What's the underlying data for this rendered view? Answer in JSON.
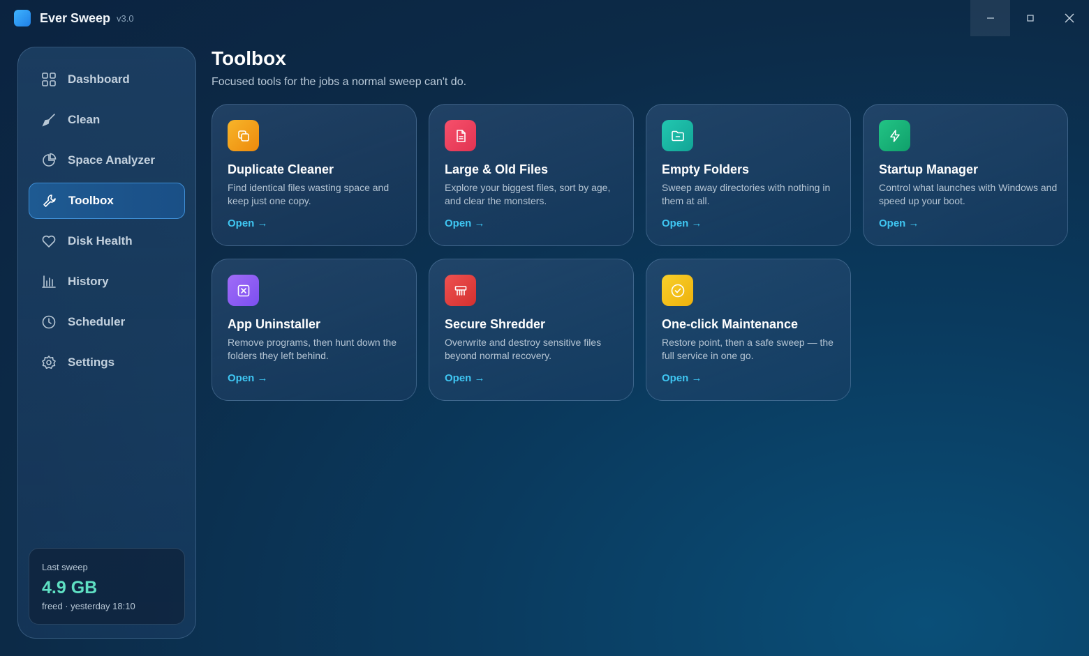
{
  "app": {
    "name": "Ever Sweep",
    "version": "v3.0"
  },
  "window_controls": {
    "minimize": "–",
    "maximize": "□",
    "close": "✕"
  },
  "sidebar": {
    "items": [
      {
        "label": "Dashboard",
        "icon": "grid-icon",
        "active": false
      },
      {
        "label": "Clean",
        "icon": "broom-icon",
        "active": false
      },
      {
        "label": "Space Analyzer",
        "icon": "pie-chart-icon",
        "active": false
      },
      {
        "label": "Toolbox",
        "icon": "wrench-icon",
        "active": true
      },
      {
        "label": "Disk Health",
        "icon": "heart-icon",
        "active": false
      },
      {
        "label": "History",
        "icon": "bar-chart-icon",
        "active": false
      },
      {
        "label": "Scheduler",
        "icon": "clock-icon",
        "active": false
      },
      {
        "label": "Settings",
        "icon": "gear-icon",
        "active": false
      }
    ],
    "last_sweep": {
      "label": "Last sweep",
      "value": "4.9 GB",
      "sub": "freed · yesterday 18:10"
    }
  },
  "main": {
    "title": "Toolbox",
    "subtitle": "Focused tools for the jobs a normal sweep can't do.",
    "cards": [
      {
        "title": "Duplicate Cleaner",
        "desc": "Find identical files wasting space and keep just one copy.",
        "open": "Open →",
        "icon": "copy-icon",
        "color": "#f29a14"
      },
      {
        "title": "Large & Old Files",
        "desc": "Explore your biggest files, sort by age, and clear the monsters.",
        "open": "Open →",
        "icon": "document-icon",
        "color": "#ef4461"
      },
      {
        "title": "Empty Folders",
        "desc": "Sweep away directories with nothing in them at all.",
        "open": "Open →",
        "icon": "folder-icon",
        "color": "#19b8a6"
      },
      {
        "title": "Startup Manager",
        "desc": "Control what launches with Windows and speed up your boot.",
        "open": "Open →",
        "icon": "lightning-icon",
        "color": "#16b27a"
      },
      {
        "title": "App Uninstaller",
        "desc": "Remove programs, then hunt down the folders they left behind.",
        "open": "Open →",
        "icon": "uninstall-icon",
        "color": "#8b5cf6"
      },
      {
        "title": "Secure Shredder",
        "desc": "Overwrite and destroy sensitive files beyond normal recovery.",
        "open": "Open →",
        "icon": "shredder-icon",
        "color": "#e3403e"
      },
      {
        "title": "One-click Maintenance",
        "desc": "Restore point, then a safe sweep — the full service in one go.",
        "open": "Open →",
        "icon": "check-circle-icon",
        "color": "#f2c014"
      }
    ]
  }
}
